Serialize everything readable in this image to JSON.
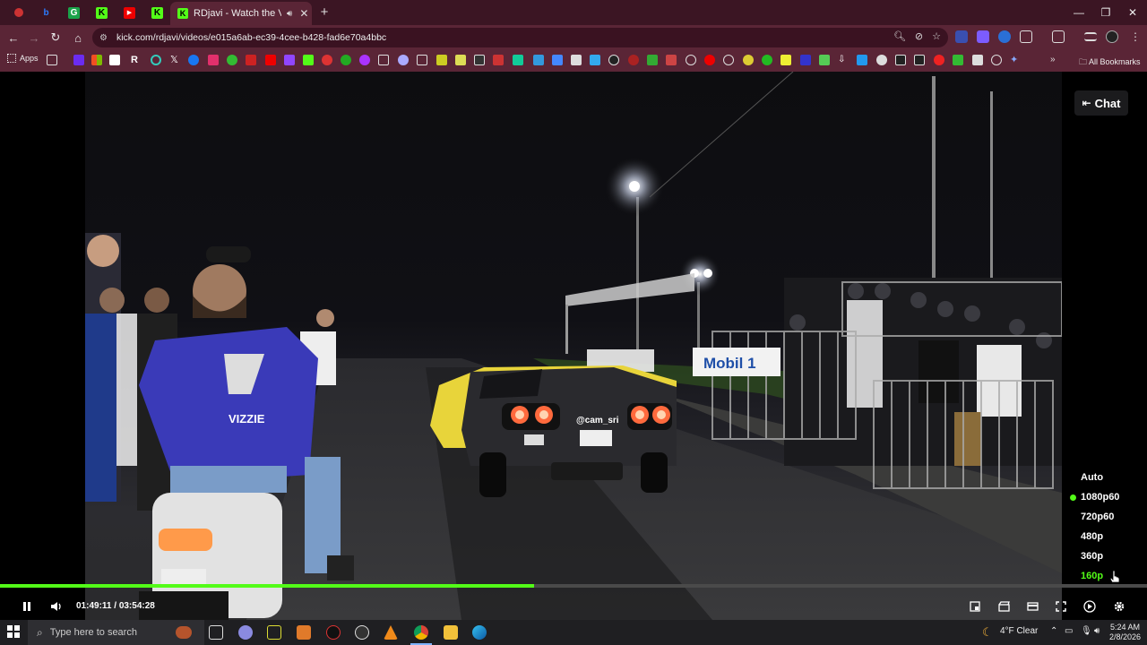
{
  "browser": {
    "active_tab_title": "RDjavi - Watch the VOD on",
    "url": "kick.com/rdjavi/videos/e015a6ab-ec39-4cee-b428-fad6e70a4bbc",
    "new_tab": "+",
    "bookmarks": {
      "apps_label": "Apps",
      "all_bookmarks_label": "All Bookmarks"
    }
  },
  "video": {
    "bib_text": "VIZZIE",
    "car_sticker": "@cam_sri",
    "banner_text": "Mobil 1"
  },
  "player": {
    "chat_label": "Chat",
    "quality_options": [
      {
        "label": "Auto",
        "selected": false
      },
      {
        "label": "1080p60",
        "selected": true
      },
      {
        "label": "720p60",
        "selected": false
      },
      {
        "label": "480p",
        "selected": false
      },
      {
        "label": "360p",
        "selected": false
      },
      {
        "label": "160p",
        "selected": false
      }
    ],
    "current_time": "01:49:11",
    "duration": "03:54:28",
    "timecode": "01:49:11 / 03:54:28",
    "progress": 0.466,
    "accent_color": "#53fc18"
  },
  "taskbar": {
    "search_placeholder": "Type here to search",
    "weather": "4°F  Clear",
    "time": "5:24 AM",
    "date": "2/8/2026"
  }
}
